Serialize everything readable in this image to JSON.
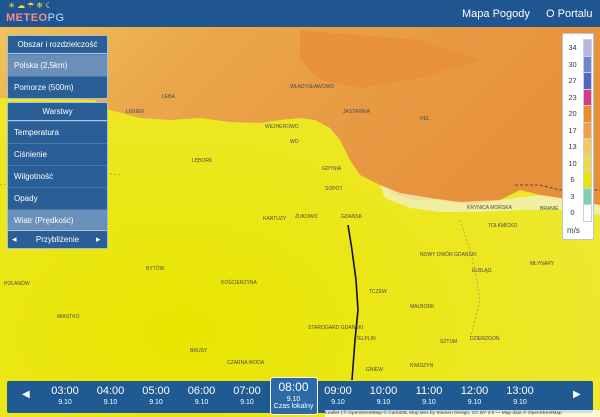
{
  "logo": {
    "brand_a": "METEO",
    "brand_b": "PG"
  },
  "nav": {
    "map": "Mapa Pogody",
    "about": "O Portalu"
  },
  "area_panel": {
    "title": "Obszar i rozdzielczość",
    "items": [
      {
        "label": "Polska (2,5km)",
        "selected": true
      },
      {
        "label": "Pomorze (500m)",
        "selected": false
      }
    ]
  },
  "layers_panel": {
    "title": "Warstwy",
    "items": [
      {
        "label": "Temperatura",
        "selected": false
      },
      {
        "label": "Ciśnienie",
        "selected": false
      },
      {
        "label": "Wilgotność",
        "selected": false
      },
      {
        "label": "Opady",
        "selected": false
      },
      {
        "label": "Wiatr (Prędkość)",
        "selected": true
      }
    ]
  },
  "zoom": {
    "label": "Przybliżenie"
  },
  "legend": {
    "unit": "m/s",
    "items": [
      {
        "value": "34",
        "color": "#b9b6e0"
      },
      {
        "value": "30",
        "color": "#6f86cf"
      },
      {
        "value": "27",
        "color": "#4e67c3"
      },
      {
        "value": "23",
        "color": "#d93a82"
      },
      {
        "value": "20",
        "color": "#ee8a2a"
      },
      {
        "value": "17",
        "color": "#f3a03c"
      },
      {
        "value": "13",
        "color": "#f5c95a"
      },
      {
        "value": "10",
        "color": "#eed84c"
      },
      {
        "value": "6",
        "color": "#e8e300"
      },
      {
        "value": "3",
        "color": "#7bd3a8"
      },
      {
        "value": "0",
        "color": "#ffffff"
      }
    ]
  },
  "places": [
    "ŁEBA",
    "ŁEBIEN",
    "WŁADYSŁAWOWO",
    "JASTARNIA",
    "WEJHEROWO",
    "HEL",
    "LĘBORK",
    "WO",
    "GDYNIA",
    "SOPOT",
    "KARTUZY",
    "ŻUKOWO",
    "GDAŃSK",
    "KRYNICA MORSKA",
    "TOLKMICKO",
    "BRANIE",
    "NOWY DWÓR GDAŃSKI",
    "ELBLĄG",
    "MŁYNARY",
    "BYTÓW",
    "KOŚCIERZYNA",
    "POLANÓW",
    "MIASTKO",
    "TCZEW",
    "MALBORK",
    "STAROGARD GDAŃSKI",
    "PELPLIN",
    "SZTUM",
    "DZIERZGOŃ",
    "BRUSY",
    "CZARNA WODA",
    "KWIDZYN",
    "GNIEW"
  ],
  "time_bar": {
    "current_label": "Czas lokalny",
    "slots": [
      {
        "time": "03:00",
        "date": "9.10"
      },
      {
        "time": "04:00",
        "date": "9.10"
      },
      {
        "time": "05:00",
        "date": "9.10"
      },
      {
        "time": "06:00",
        "date": "9.10"
      },
      {
        "time": "07:00",
        "date": "9.10"
      },
      {
        "time": "08:00",
        "date": "9.10",
        "active": true
      },
      {
        "time": "09:00",
        "date": "9.10"
      },
      {
        "time": "10:00",
        "date": "9.10"
      },
      {
        "time": "11:00",
        "date": "9.10"
      },
      {
        "time": "12:00",
        "date": "9.10"
      },
      {
        "time": "13:00",
        "date": "9.10"
      }
    ]
  },
  "attribution": "Leaflet | © OpenStreetMap © CartoDB, Map tiles by Stamen Design, CC BY 3.0 — Map data © OpenStreetMap"
}
